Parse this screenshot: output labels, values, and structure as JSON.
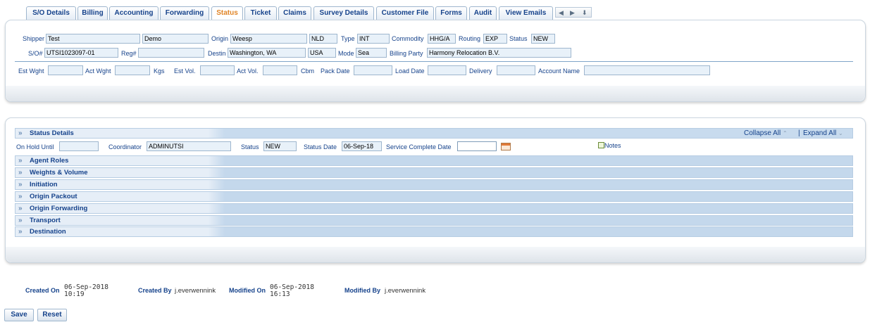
{
  "tabs": [
    {
      "label": "S/O Details",
      "active": false
    },
    {
      "label": "Billing",
      "active": false
    },
    {
      "label": "Accounting",
      "active": false
    },
    {
      "label": "Forwarding",
      "active": false
    },
    {
      "label": "Status",
      "active": true
    },
    {
      "label": "Ticket",
      "active": false
    },
    {
      "label": "Claims",
      "active": false
    },
    {
      "label": "Survey Details",
      "active": false
    },
    {
      "label": "Customer File",
      "active": false
    },
    {
      "label": "Forms",
      "active": false
    },
    {
      "label": "Audit",
      "active": false
    },
    {
      "label": "View Emails",
      "active": false
    }
  ],
  "tab_nav": {
    "left": "◀",
    "right": "▶",
    "down": "⬇"
  },
  "header": {
    "shipper_label": "Shipper",
    "shipper_first": "Test",
    "shipper_last": "Demo",
    "origin_label": "Origin",
    "origin_city": "Weesp",
    "origin_country": "NLD",
    "type_label": "Type",
    "type_value": "INT",
    "commodity_label": "Commodity",
    "commodity_value": "HHG/A",
    "routing_label": "Routing",
    "routing_value": "EXP",
    "status_label": "Status",
    "status_value": "NEW",
    "so_label": "S/O#",
    "so_value": "UTSI1023097-01",
    "reg_label": "Reg#",
    "reg_value": "",
    "destin_label": "Destin",
    "destin_city": "Washington, WA",
    "destin_country": "USA",
    "mode_label": "Mode",
    "mode_value": "Sea",
    "billing_label": "Billing Party",
    "billing_value": "Harmony Relocation B.V.",
    "est_wght_label": "Est Wght",
    "est_wght_value": "",
    "act_wght_label": "Act Wght",
    "act_wght_value": "",
    "kgs_label": "Kgs",
    "est_vol_label": "Est Vol.",
    "est_vol_value": "",
    "act_vol_label": "Act Vol.",
    "act_vol_value": "",
    "cbm_label": "Cbm",
    "pack_date_label": "Pack Date",
    "pack_date_value": "",
    "load_date_label": "Load Date",
    "load_date_value": "",
    "delivery_label": "Delivery",
    "delivery_value": "",
    "account_label": "Account Name",
    "account_value": ""
  },
  "status_panel": {
    "title": "Status Details",
    "collapse_all": "Collapse All",
    "expand_all": "Expand All",
    "separator": "|",
    "on_hold_label": "On Hold Until",
    "on_hold_value": "",
    "coordinator_label": "Coordinator",
    "coordinator_value": "ADMINUTSI",
    "status_label": "Status",
    "status_value": "NEW",
    "status_date_label": "Status Date",
    "status_date_value": "06-Sep-18",
    "service_complete_label": "Service Complete Date",
    "service_complete_value": "",
    "notes_label": "Notes",
    "sections": [
      {
        "label": "Agent Roles"
      },
      {
        "label": "Weights & Volume"
      },
      {
        "label": "Initiation"
      },
      {
        "label": "Origin Packout"
      },
      {
        "label": "Origin Forwarding"
      },
      {
        "label": "Transport"
      },
      {
        "label": "Destination"
      }
    ]
  },
  "footer": {
    "created_on_label": "Created On",
    "created_on_date": "06-Sep-2018",
    "created_on_time": "10:19",
    "created_by_label": "Created By",
    "created_by_value": "j.everwennink",
    "modified_on_label": "Modified On",
    "modified_on_date": "06-Sep-2018",
    "modified_on_time": "16:13",
    "modified_by_label": "Modified By",
    "modified_by_value": "j.everwennink"
  },
  "buttons": {
    "save": "Save",
    "reset": "Reset"
  },
  "colors": {
    "accent": "#15428b",
    "active_tab": "#e08426",
    "field_bg": "#e8f1f9",
    "section_bar": "#c4d8ec"
  }
}
